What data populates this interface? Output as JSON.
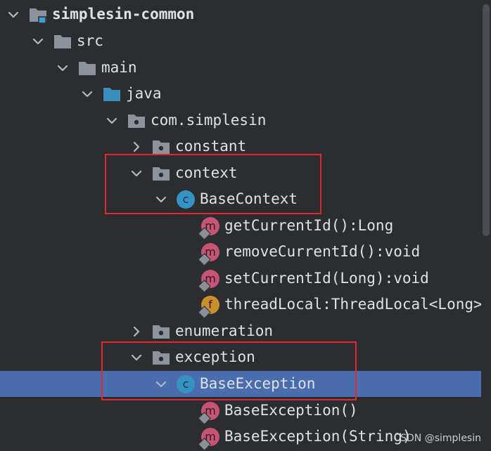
{
  "tree": {
    "nodes": [
      {
        "label": "simplesin-common",
        "icon": "module-folder-icon",
        "expanded": true,
        "bold": true
      },
      {
        "label": "src",
        "icon": "folder-icon",
        "expanded": true
      },
      {
        "label": "main",
        "icon": "folder-icon",
        "expanded": true
      },
      {
        "label": "java",
        "icon": "source-root-folder-icon",
        "expanded": true
      },
      {
        "label": "com.simplesin",
        "icon": "package-icon",
        "expanded": true
      },
      {
        "label": "constant",
        "icon": "package-icon",
        "expanded": false
      },
      {
        "label": "context",
        "icon": "package-icon",
        "expanded": true
      },
      {
        "label": "BaseContext",
        "icon": "class-icon",
        "expanded": true
      },
      {
        "label": "getCurrentId():Long",
        "icon": "method-icon"
      },
      {
        "label": "removeCurrentId():void",
        "icon": "method-icon"
      },
      {
        "label": "setCurrentId(Long):void",
        "icon": "method-icon"
      },
      {
        "label": "threadLocal:ThreadLocal<Long>",
        "icon": "field-icon"
      },
      {
        "label": "enumeration",
        "icon": "package-icon",
        "expanded": false
      },
      {
        "label": "exception",
        "icon": "package-icon",
        "expanded": true
      },
      {
        "label": "BaseException",
        "icon": "class-icon",
        "expanded": true,
        "selected": true
      },
      {
        "label": "BaseException()",
        "icon": "method-icon"
      },
      {
        "label": "BaseException(String)",
        "icon": "method-icon"
      }
    ]
  },
  "icon_letters": {
    "class": "c",
    "method": "m",
    "field": "f"
  },
  "watermark": "CSDN @simplesin",
  "colors": {
    "background": "#2b2d30",
    "selection": "#4a6db0",
    "highlight_box": "#e0282d",
    "class_icon": "#3592c4",
    "method_icon": "#c75474",
    "field_icon": "#c98f2b"
  }
}
